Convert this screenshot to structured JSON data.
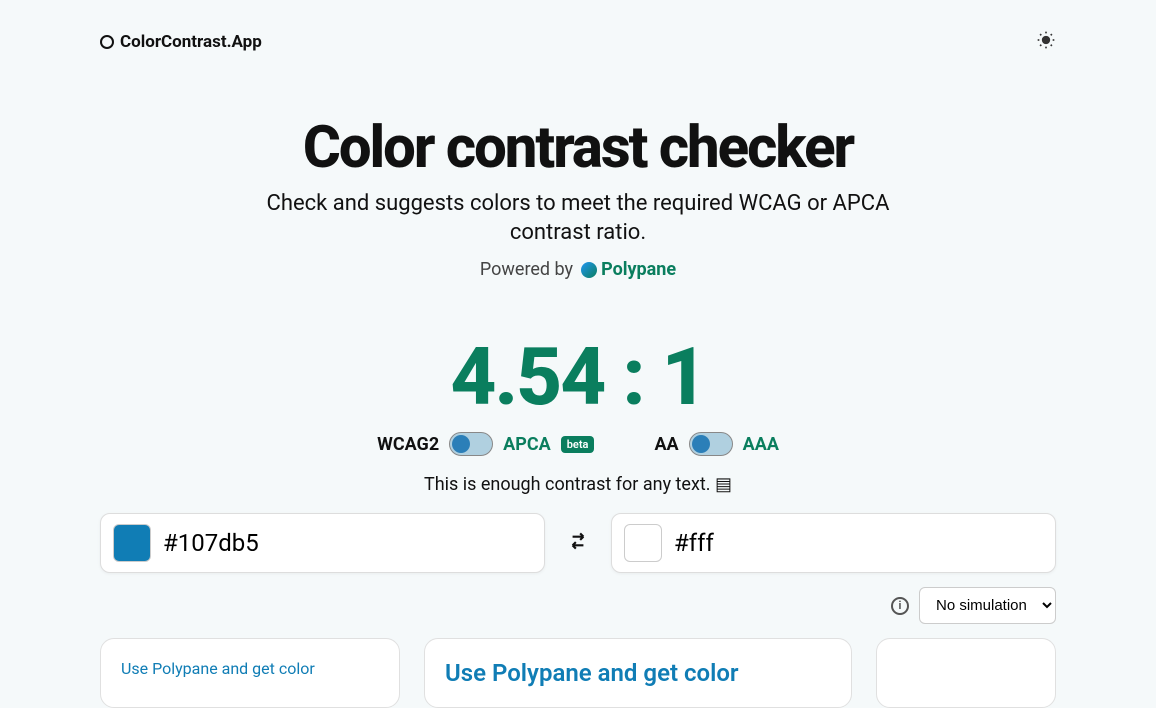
{
  "header": {
    "app_name": "ColorContrast.App"
  },
  "hero": {
    "title": "Color contrast checker",
    "subtitle": "Check and suggests colors to meet the required WCAG or APCA contrast ratio.",
    "powered_by": "Powered by",
    "brand": "Polypane"
  },
  "result": {
    "ratio_display": "4.54 : 1",
    "status": "This is enough contrast for any text."
  },
  "toggles": {
    "wcag2": "WCAG2",
    "apca": "APCA",
    "beta": "beta",
    "aa": "AA",
    "aaa": "AAA"
  },
  "colors": {
    "foreground": "#107db5",
    "background": "#fff",
    "foreground_swatch": "#107db5",
    "background_swatch": "#ffffff"
  },
  "simulation": {
    "selected": "No simulation"
  },
  "preview": {
    "card_text": "Use Polypane and get color"
  }
}
